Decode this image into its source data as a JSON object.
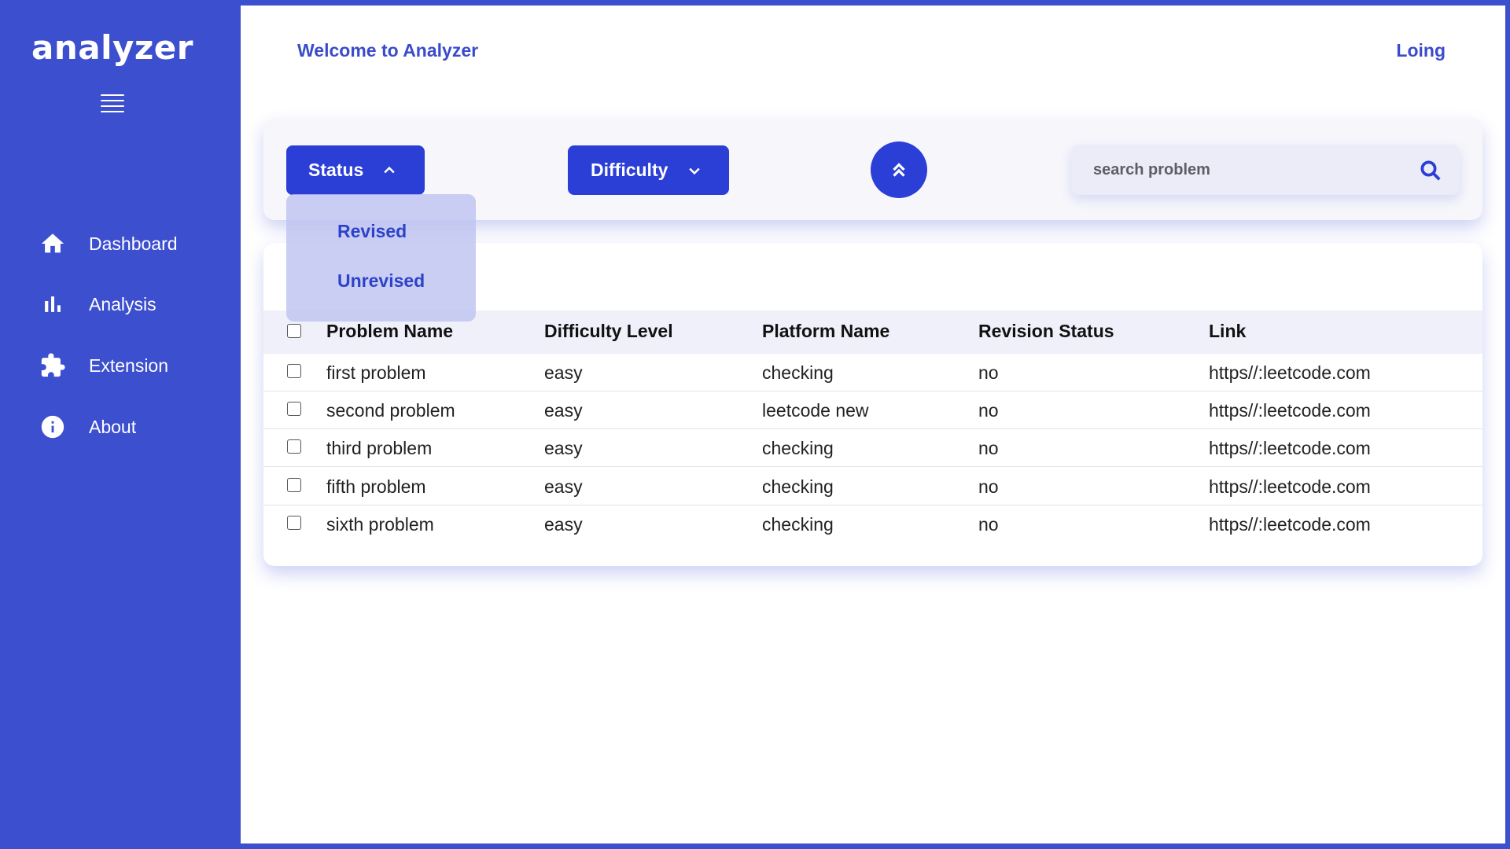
{
  "app": {
    "logo": "analyzer"
  },
  "sidebar": {
    "items": [
      {
        "label": "Dashboard",
        "icon": "home-icon"
      },
      {
        "label": "Analysis",
        "icon": "bar-chart-icon"
      },
      {
        "label": "Extension",
        "icon": "puzzle-icon"
      },
      {
        "label": "About",
        "icon": "info-icon"
      }
    ]
  },
  "header": {
    "welcome": "Welcome to Analyzer",
    "login": "Loing"
  },
  "filters": {
    "status_label": "Status",
    "difficulty_label": "Difficulty",
    "status_options": [
      "Revised",
      "Unrevised"
    ],
    "search_placeholder": "search problem"
  },
  "table": {
    "columns": [
      "Problem Name",
      "Difficulty Level",
      "Platform Name",
      "Revision Status",
      "Link"
    ],
    "rows": [
      [
        "first problem",
        "easy",
        "checking",
        "no",
        "https//:leetcode.com"
      ],
      [
        "second problem",
        "easy",
        "leetcode new",
        "no",
        "https//:leetcode.com"
      ],
      [
        "third problem",
        "easy",
        "checking",
        "no",
        "https//:leetcode.com"
      ],
      [
        "fifth problem",
        "easy",
        "checking",
        "no",
        "https//:leetcode.com"
      ],
      [
        "sixth problem",
        "easy",
        "checking",
        "no",
        "https//:leetcode.com"
      ]
    ]
  },
  "colors": {
    "brand": "#3c4fcf",
    "button": "#2b3ed6",
    "text_accent": "#3a4bcc"
  }
}
